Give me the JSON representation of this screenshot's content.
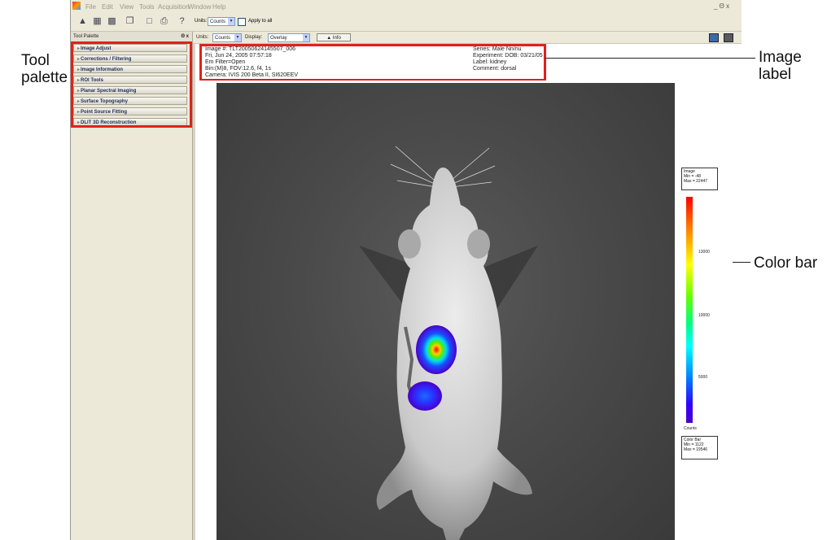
{
  "menu": [
    "File",
    "Edit",
    "View",
    "Tools",
    "Acquisition",
    "Window",
    "Help"
  ],
  "window_controls": "_ Θ x",
  "toolbar": {
    "units_label": "Units:",
    "units_value": "Counts",
    "apply_label": "Apply to all"
  },
  "tool_palette": {
    "title": "Tool Palette",
    "controls": "Θ x",
    "items": [
      "Image Adjust",
      "Corrections / Filtering",
      "Image Information",
      "ROI Tools",
      "Planar Spectral Imaging",
      "Surface Topography",
      "Point Source Fitting",
      "DLIT 3D Reconstruction"
    ]
  },
  "view_bar": {
    "units_label": "Units:",
    "units_value": "Counts",
    "display_label": "Display:",
    "display_value": "Overlay",
    "info_button": "▲ Info"
  },
  "image_label": {
    "left": [
      "Image #: TLT20050624145507_006",
      "Fri, Jun 24, 2005 07:57:18",
      "Em Filter=Open",
      "Bin:(M)8, FOV:12.6, f4, 1s",
      "Camera: IVIS 200 Beta II, SI620EEV"
    ],
    "right": [
      "Series: Male Nn/nu",
      "Experiment: DOB: 03/21/05",
      "Label: kidney",
      "Comment: dorsal"
    ]
  },
  "color_scale": {
    "image_box": [
      "Image",
      "Min = -48",
      "Max = 22447"
    ],
    "ticks": [
      "13000",
      "10000",
      "5000"
    ],
    "units": "Counts",
    "bar_box": [
      "Color Bar",
      "Min = 1122",
      "Max = 19546"
    ],
    "gradient": [
      "#ff0000",
      "#ffff00",
      "#00ff00",
      "#00ffff",
      "#0000ff",
      "#4b00c8"
    ]
  },
  "callouts": {
    "tool_palette": "Tool palette",
    "image_label": "Image label",
    "color_bar": "Color bar"
  }
}
